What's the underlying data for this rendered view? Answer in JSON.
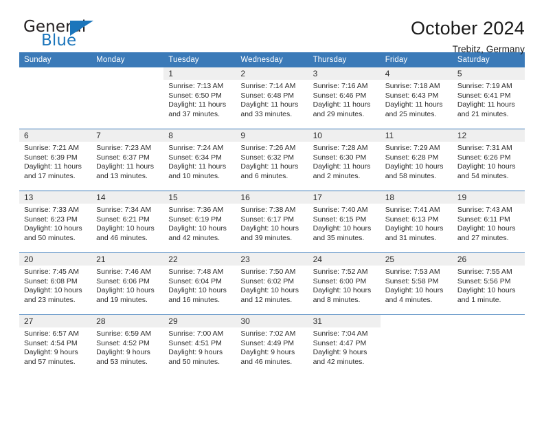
{
  "brand": {
    "word1": "General",
    "word2": "Blue",
    "flag_color": "#1b75bb"
  },
  "header": {
    "title": "October 2024",
    "location": "Trebitz, Germany"
  },
  "theme": {
    "header_bar": "#3b7ab8",
    "daynum_band": "#efefef",
    "text": "#2b2b2b"
  },
  "weekdays": [
    "Sunday",
    "Monday",
    "Tuesday",
    "Wednesday",
    "Thursday",
    "Friday",
    "Saturday"
  ],
  "weeks": [
    [
      {
        "day": "",
        "blank": true
      },
      {
        "day": "",
        "blank": true
      },
      {
        "day": "1",
        "sunrise": "Sunrise: 7:13 AM",
        "sunset": "Sunset: 6:50 PM",
        "daylight1": "Daylight: 11 hours",
        "daylight2": "and 37 minutes."
      },
      {
        "day": "2",
        "sunrise": "Sunrise: 7:14 AM",
        "sunset": "Sunset: 6:48 PM",
        "daylight1": "Daylight: 11 hours",
        "daylight2": "and 33 minutes."
      },
      {
        "day": "3",
        "sunrise": "Sunrise: 7:16 AM",
        "sunset": "Sunset: 6:46 PM",
        "daylight1": "Daylight: 11 hours",
        "daylight2": "and 29 minutes."
      },
      {
        "day": "4",
        "sunrise": "Sunrise: 7:18 AM",
        "sunset": "Sunset: 6:43 PM",
        "daylight1": "Daylight: 11 hours",
        "daylight2": "and 25 minutes."
      },
      {
        "day": "5",
        "sunrise": "Sunrise: 7:19 AM",
        "sunset": "Sunset: 6:41 PM",
        "daylight1": "Daylight: 11 hours",
        "daylight2": "and 21 minutes."
      }
    ],
    [
      {
        "day": "6",
        "sunrise": "Sunrise: 7:21 AM",
        "sunset": "Sunset: 6:39 PM",
        "daylight1": "Daylight: 11 hours",
        "daylight2": "and 17 minutes."
      },
      {
        "day": "7",
        "sunrise": "Sunrise: 7:23 AM",
        "sunset": "Sunset: 6:37 PM",
        "daylight1": "Daylight: 11 hours",
        "daylight2": "and 13 minutes."
      },
      {
        "day": "8",
        "sunrise": "Sunrise: 7:24 AM",
        "sunset": "Sunset: 6:34 PM",
        "daylight1": "Daylight: 11 hours",
        "daylight2": "and 10 minutes."
      },
      {
        "day": "9",
        "sunrise": "Sunrise: 7:26 AM",
        "sunset": "Sunset: 6:32 PM",
        "daylight1": "Daylight: 11 hours",
        "daylight2": "and 6 minutes."
      },
      {
        "day": "10",
        "sunrise": "Sunrise: 7:28 AM",
        "sunset": "Sunset: 6:30 PM",
        "daylight1": "Daylight: 11 hours",
        "daylight2": "and 2 minutes."
      },
      {
        "day": "11",
        "sunrise": "Sunrise: 7:29 AM",
        "sunset": "Sunset: 6:28 PM",
        "daylight1": "Daylight: 10 hours",
        "daylight2": "and 58 minutes."
      },
      {
        "day": "12",
        "sunrise": "Sunrise: 7:31 AM",
        "sunset": "Sunset: 6:26 PM",
        "daylight1": "Daylight: 10 hours",
        "daylight2": "and 54 minutes."
      }
    ],
    [
      {
        "day": "13",
        "sunrise": "Sunrise: 7:33 AM",
        "sunset": "Sunset: 6:23 PM",
        "daylight1": "Daylight: 10 hours",
        "daylight2": "and 50 minutes."
      },
      {
        "day": "14",
        "sunrise": "Sunrise: 7:34 AM",
        "sunset": "Sunset: 6:21 PM",
        "daylight1": "Daylight: 10 hours",
        "daylight2": "and 46 minutes."
      },
      {
        "day": "15",
        "sunrise": "Sunrise: 7:36 AM",
        "sunset": "Sunset: 6:19 PM",
        "daylight1": "Daylight: 10 hours",
        "daylight2": "and 42 minutes."
      },
      {
        "day": "16",
        "sunrise": "Sunrise: 7:38 AM",
        "sunset": "Sunset: 6:17 PM",
        "daylight1": "Daylight: 10 hours",
        "daylight2": "and 39 minutes."
      },
      {
        "day": "17",
        "sunrise": "Sunrise: 7:40 AM",
        "sunset": "Sunset: 6:15 PM",
        "daylight1": "Daylight: 10 hours",
        "daylight2": "and 35 minutes."
      },
      {
        "day": "18",
        "sunrise": "Sunrise: 7:41 AM",
        "sunset": "Sunset: 6:13 PM",
        "daylight1": "Daylight: 10 hours",
        "daylight2": "and 31 minutes."
      },
      {
        "day": "19",
        "sunrise": "Sunrise: 7:43 AM",
        "sunset": "Sunset: 6:11 PM",
        "daylight1": "Daylight: 10 hours",
        "daylight2": "and 27 minutes."
      }
    ],
    [
      {
        "day": "20",
        "sunrise": "Sunrise: 7:45 AM",
        "sunset": "Sunset: 6:08 PM",
        "daylight1": "Daylight: 10 hours",
        "daylight2": "and 23 minutes."
      },
      {
        "day": "21",
        "sunrise": "Sunrise: 7:46 AM",
        "sunset": "Sunset: 6:06 PM",
        "daylight1": "Daylight: 10 hours",
        "daylight2": "and 19 minutes."
      },
      {
        "day": "22",
        "sunrise": "Sunrise: 7:48 AM",
        "sunset": "Sunset: 6:04 PM",
        "daylight1": "Daylight: 10 hours",
        "daylight2": "and 16 minutes."
      },
      {
        "day": "23",
        "sunrise": "Sunrise: 7:50 AM",
        "sunset": "Sunset: 6:02 PM",
        "daylight1": "Daylight: 10 hours",
        "daylight2": "and 12 minutes."
      },
      {
        "day": "24",
        "sunrise": "Sunrise: 7:52 AM",
        "sunset": "Sunset: 6:00 PM",
        "daylight1": "Daylight: 10 hours",
        "daylight2": "and 8 minutes."
      },
      {
        "day": "25",
        "sunrise": "Sunrise: 7:53 AM",
        "sunset": "Sunset: 5:58 PM",
        "daylight1": "Daylight: 10 hours",
        "daylight2": "and 4 minutes."
      },
      {
        "day": "26",
        "sunrise": "Sunrise: 7:55 AM",
        "sunset": "Sunset: 5:56 PM",
        "daylight1": "Daylight: 10 hours",
        "daylight2": "and 1 minute."
      }
    ],
    [
      {
        "day": "27",
        "sunrise": "Sunrise: 6:57 AM",
        "sunset": "Sunset: 4:54 PM",
        "daylight1": "Daylight: 9 hours",
        "daylight2": "and 57 minutes."
      },
      {
        "day": "28",
        "sunrise": "Sunrise: 6:59 AM",
        "sunset": "Sunset: 4:52 PM",
        "daylight1": "Daylight: 9 hours",
        "daylight2": "and 53 minutes."
      },
      {
        "day": "29",
        "sunrise": "Sunrise: 7:00 AM",
        "sunset": "Sunset: 4:51 PM",
        "daylight1": "Daylight: 9 hours",
        "daylight2": "and 50 minutes."
      },
      {
        "day": "30",
        "sunrise": "Sunrise: 7:02 AM",
        "sunset": "Sunset: 4:49 PM",
        "daylight1": "Daylight: 9 hours",
        "daylight2": "and 46 minutes."
      },
      {
        "day": "31",
        "sunrise": "Sunrise: 7:04 AM",
        "sunset": "Sunset: 4:47 PM",
        "daylight1": "Daylight: 9 hours",
        "daylight2": "and 42 minutes."
      },
      {
        "day": "",
        "blank": true
      },
      {
        "day": "",
        "blank": true
      }
    ]
  ]
}
